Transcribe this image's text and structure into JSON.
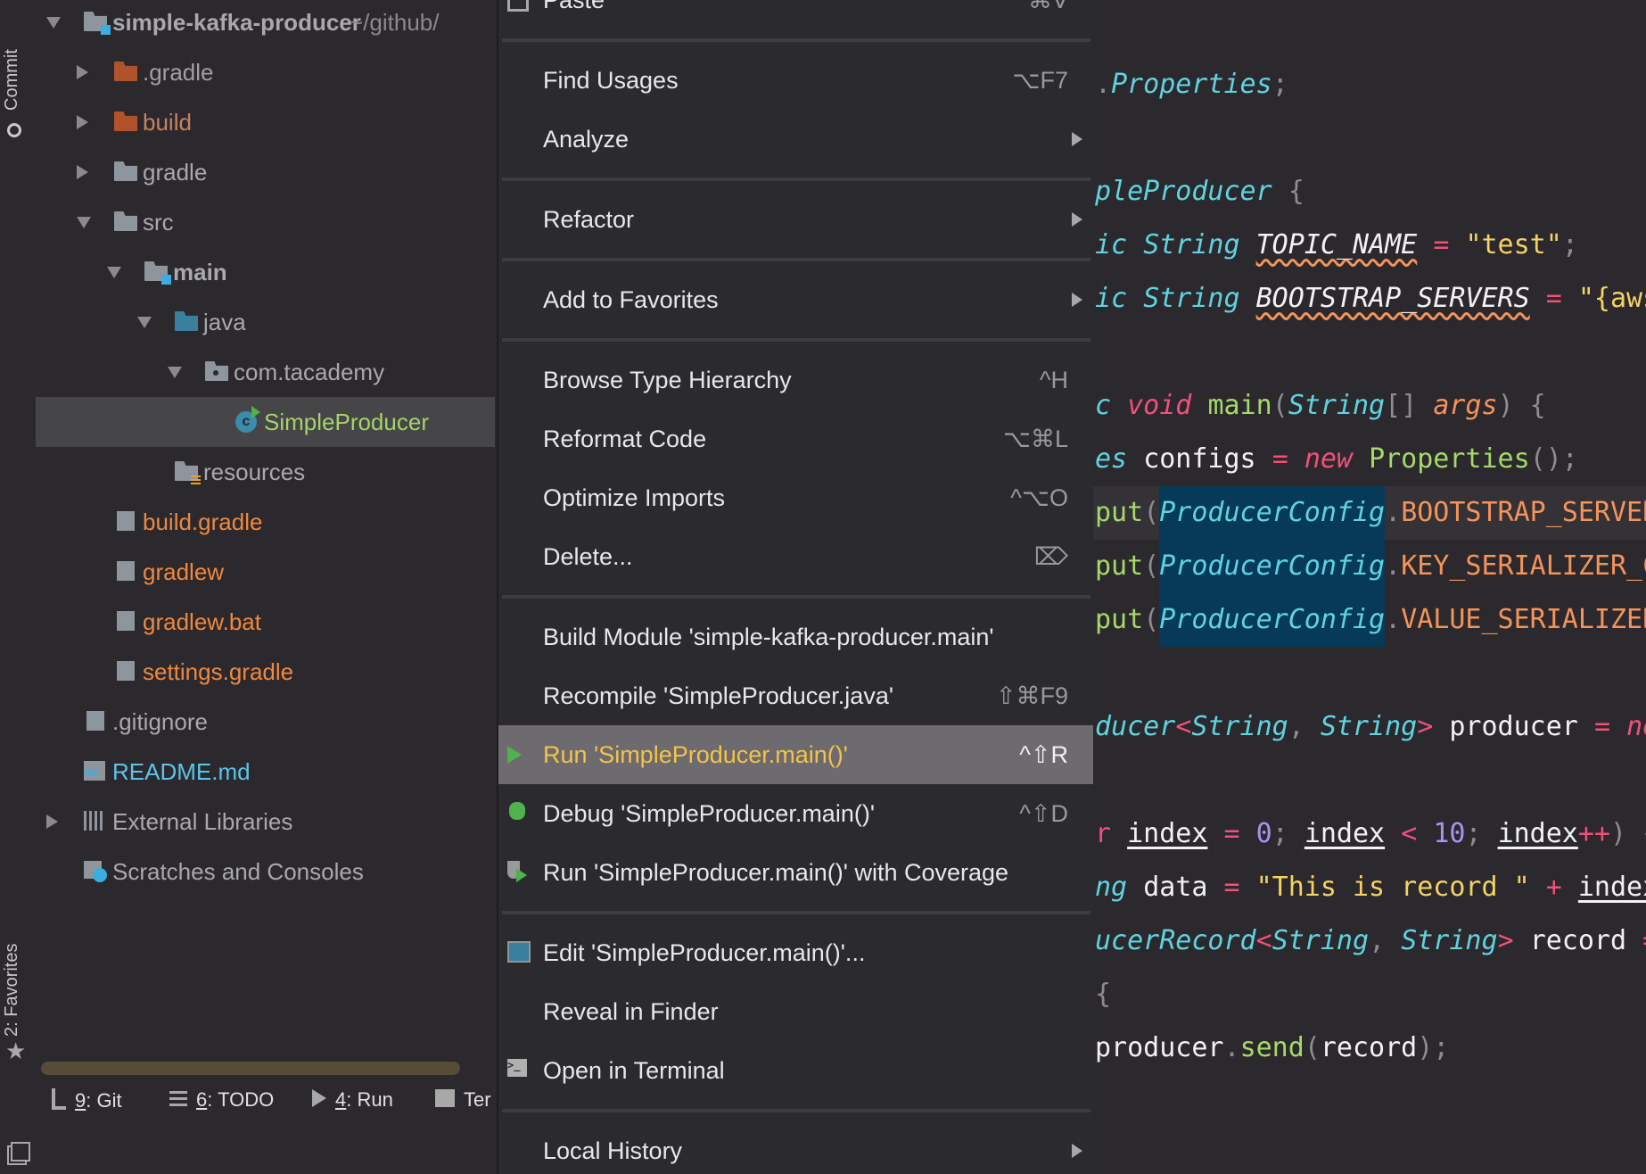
{
  "side_strip": {
    "commit_label": "Commit",
    "favorites_label": "2: Favorites"
  },
  "project_tree": {
    "items": [
      {
        "label": "simple-kafka-producer",
        "suffix": "~/github/",
        "depth": 0,
        "arrow": "expanded",
        "icon": "module-folder-icon",
        "color": "#a9a9ab",
        "bold": true
      },
      {
        "label": ".gradle",
        "depth": 1,
        "arrow": "collapsed",
        "icon": "excluded-folder-icon",
        "color": "#a0a0a2"
      },
      {
        "label": "build",
        "depth": 1,
        "arrow": "collapsed",
        "icon": "excluded-folder-icon",
        "color": "#c8835e"
      },
      {
        "label": "gradle",
        "depth": 1,
        "arrow": "collapsed",
        "icon": "folder-icon",
        "color": "#a9a9ab"
      },
      {
        "label": "src",
        "depth": 1,
        "arrow": "expanded",
        "icon": "folder-icon",
        "color": "#a9a9ab"
      },
      {
        "label": "main",
        "depth": 2,
        "arrow": "expanded",
        "icon": "module-folder-icon",
        "color": "#a9a9ab",
        "bold": true
      },
      {
        "label": "java",
        "depth": 3,
        "arrow": "expanded",
        "icon": "source-folder-icon",
        "color": "#a9a9ab"
      },
      {
        "label": "com.tacademy",
        "depth": 4,
        "arrow": "expanded",
        "icon": "package-icon",
        "color": "#a9a9ab"
      },
      {
        "label": "SimpleProducer",
        "depth": 5,
        "arrow": "none",
        "icon": "java-class-icon",
        "color": "#a6d36a",
        "selected": true
      },
      {
        "label": "resources",
        "depth": 3,
        "arrow": "none",
        "icon": "resources-folder-icon",
        "color": "#a9a9ab"
      },
      {
        "label": "build.gradle",
        "depth": 1,
        "arrow": "none",
        "icon": "gradle-icon",
        "color": "#f0883e"
      },
      {
        "label": "gradlew",
        "depth": 1,
        "arrow": "none",
        "icon": "shell-script-icon",
        "color": "#f0883e"
      },
      {
        "label": "gradlew.bat",
        "depth": 1,
        "arrow": "none",
        "icon": "text-file-icon",
        "color": "#f0883e"
      },
      {
        "label": "settings.gradle",
        "depth": 1,
        "arrow": "none",
        "icon": "gradle-icon",
        "color": "#f0883e"
      },
      {
        "label": ".gitignore",
        "depth": 0,
        "arrow": "none",
        "icon": "ignore-file-icon",
        "color": "#a9a9ab"
      },
      {
        "label": "README.md",
        "depth": 0,
        "arrow": "none",
        "icon": "markdown-file-icon",
        "color": "#5bc4ea"
      },
      {
        "label": "External Libraries",
        "depth": 0,
        "arrow": "collapsed",
        "icon": "libraries-icon",
        "color": "#a9a9ab"
      },
      {
        "label": "Scratches and Consoles",
        "depth": 0,
        "arrow": "none",
        "icon": "scratches-icon",
        "color": "#a9a9ab"
      }
    ]
  },
  "context_menu": {
    "items": [
      {
        "label": "Paste",
        "shortcut": "⌘V",
        "icon": "paste-icon"
      },
      {
        "separator": true
      },
      {
        "label": "Find Usages",
        "shortcut": "⌥F7"
      },
      {
        "label": "Analyze",
        "submenu": true
      },
      {
        "separator": true
      },
      {
        "label": "Refactor",
        "submenu": true
      },
      {
        "separator": true
      },
      {
        "label": "Add to Favorites",
        "submenu": true
      },
      {
        "separator": true
      },
      {
        "label": "Browse Type Hierarchy",
        "shortcut": "^H"
      },
      {
        "label": "Reformat Code",
        "shortcut": "⌥⌘L"
      },
      {
        "label": "Optimize Imports",
        "shortcut": "^⌥O"
      },
      {
        "label": "Delete...",
        "shortcut": "⌦"
      },
      {
        "separator": true
      },
      {
        "label": "Build Module 'simple-kafka-producer.main'"
      },
      {
        "label": "Recompile 'SimpleProducer.java'",
        "shortcut": "⇧⌘F9"
      },
      {
        "label": "Run 'SimpleProducer.main()'",
        "shortcut": "^⇧R",
        "icon": "run-icon",
        "highlighted": true
      },
      {
        "label": "Debug 'SimpleProducer.main()'",
        "shortcut": "^⇧D",
        "icon": "debug-icon"
      },
      {
        "label": "Run 'SimpleProducer.main()' with Coverage",
        "icon": "coverage-icon"
      },
      {
        "separator": true
      },
      {
        "label": "Edit 'SimpleProducer.main()'...",
        "icon": "edit-config-icon"
      },
      {
        "label": "Reveal in Finder"
      },
      {
        "label": "Open in Terminal",
        "icon": "terminal-icon"
      },
      {
        "separator": true
      },
      {
        "label": "Local History",
        "submenu": true
      }
    ]
  },
  "editor": {
    "lines": [
      [
        [
          ".",
          "punc"
        ],
        [
          "Properties",
          "type"
        ],
        [
          ";",
          "punc"
        ]
      ],
      [],
      [
        [
          "pleProducer",
          "type"
        ],
        [
          " {",
          "punc"
        ]
      ],
      [
        [
          "ic ",
          "type"
        ],
        [
          "String",
          "type"
        ],
        [
          " "
        ],
        [
          "TOPIC_NAME",
          "static"
        ],
        [
          " "
        ],
        [
          "=",
          "kw"
        ],
        [
          " "
        ],
        [
          "\"test\"",
          "str"
        ],
        [
          ";",
          "punc"
        ]
      ],
      [
        [
          "ic ",
          "type"
        ],
        [
          "String",
          "type"
        ],
        [
          " "
        ],
        [
          "BOOTSTRAP_SERVERS",
          "static"
        ],
        [
          " "
        ],
        [
          "=",
          "kw"
        ],
        [
          " "
        ],
        [
          "\"{aws",
          "str"
        ]
      ],
      [],
      [
        [
          "c ",
          "type"
        ],
        [
          "void",
          "kwi"
        ],
        [
          " "
        ],
        [
          "main",
          "fn"
        ],
        [
          "(",
          "punc"
        ],
        [
          "String",
          "type"
        ],
        [
          "[]",
          "punc"
        ],
        [
          " "
        ],
        [
          "args",
          "param"
        ],
        [
          ")",
          "punc"
        ],
        [
          " {",
          "punc"
        ]
      ],
      [
        [
          "es",
          "type"
        ],
        [
          " "
        ],
        [
          "configs",
          "var"
        ],
        [
          " "
        ],
        [
          "=",
          "kw"
        ],
        [
          " "
        ],
        [
          "new",
          "kwi"
        ],
        [
          " "
        ],
        [
          "Properties",
          "fn"
        ],
        [
          "();",
          "punc"
        ]
      ],
      [
        [
          "put",
          "fn"
        ],
        [
          "(",
          "punc"
        ],
        [
          "ProducerConfig",
          "type",
          "hl"
        ],
        [
          ".",
          "punc"
        ],
        [
          "BOOTSTRAP_SERVERS",
          "const"
        ]
      ],
      [
        [
          "put",
          "fn"
        ],
        [
          "(",
          "punc"
        ],
        [
          "ProducerConfig",
          "type",
          "hl"
        ],
        [
          ".",
          "punc"
        ],
        [
          "KEY_SERIALIZER_CLASS",
          "const"
        ]
      ],
      [
        [
          "put",
          "fn"
        ],
        [
          "(",
          "punc"
        ],
        [
          "ProducerConfig",
          "type",
          "hl"
        ],
        [
          ".",
          "punc"
        ],
        [
          "VALUE_SERIALIZER",
          "const"
        ]
      ],
      [],
      [
        [
          "ducer",
          "type"
        ],
        [
          "<",
          "kw"
        ],
        [
          "String",
          "type"
        ],
        [
          ", ",
          "punc"
        ],
        [
          "String",
          "type"
        ],
        [
          ">",
          "kw"
        ],
        [
          " "
        ],
        [
          "producer",
          "var"
        ],
        [
          " "
        ],
        [
          "=",
          "kw"
        ],
        [
          " "
        ],
        [
          "ne",
          "kwi"
        ]
      ],
      [],
      [
        [
          "r ",
          "kw"
        ],
        [
          "index",
          "ul"
        ],
        [
          " "
        ],
        [
          "=",
          "kw"
        ],
        [
          " "
        ],
        [
          "0",
          "num"
        ],
        [
          "; ",
          "punc"
        ],
        [
          "index",
          "ul"
        ],
        [
          " "
        ],
        [
          "<",
          "kw"
        ],
        [
          " "
        ],
        [
          "10",
          "num"
        ],
        [
          "; ",
          "punc"
        ],
        [
          "index",
          "ul"
        ],
        [
          "++",
          "kw"
        ],
        [
          ")",
          "punc"
        ],
        [
          " {",
          "punc"
        ]
      ],
      [
        [
          "ng",
          "type"
        ],
        [
          " "
        ],
        [
          "data",
          "var"
        ],
        [
          " "
        ],
        [
          "=",
          "kw"
        ],
        [
          " "
        ],
        [
          "\"This is record \"",
          "str"
        ],
        [
          " "
        ],
        [
          "+",
          "kw"
        ],
        [
          " "
        ],
        [
          "index",
          "ul"
        ]
      ],
      [
        [
          "ucerRecord",
          "type"
        ],
        [
          "<",
          "kw"
        ],
        [
          "String",
          "type"
        ],
        [
          ", ",
          "punc"
        ],
        [
          "String",
          "type"
        ],
        [
          ">",
          "kw"
        ],
        [
          " "
        ],
        [
          "record",
          "var"
        ],
        [
          " "
        ],
        [
          "=",
          "kw"
        ]
      ],
      [
        [
          "{",
          "punc"
        ]
      ],
      [
        [
          "producer",
          "var"
        ],
        [
          ".",
          "punc"
        ],
        [
          "send",
          "fn"
        ],
        [
          "(",
          "punc"
        ],
        [
          "record",
          "var"
        ],
        [
          ");",
          "punc"
        ]
      ]
    ],
    "current_line": 8
  },
  "tool_windows": [
    {
      "mnemonic": "9",
      "label": ": Git",
      "icon": "git-icon"
    },
    {
      "mnemonic": "6",
      "label": ": TODO",
      "icon": "todo-list-icon"
    },
    {
      "mnemonic": "4",
      "label": ": Run",
      "icon": "run-icon"
    },
    {
      "mnemonic": "",
      "label": "Ter",
      "icon": "terminal-icon"
    }
  ],
  "colors": {
    "background": "#2b292d",
    "menu_highlight": "#6d6b6f",
    "run_label": "#f5c344",
    "selection": "#464548",
    "identifier_highlight": "#063a58",
    "scrollbar": "#564c38"
  }
}
